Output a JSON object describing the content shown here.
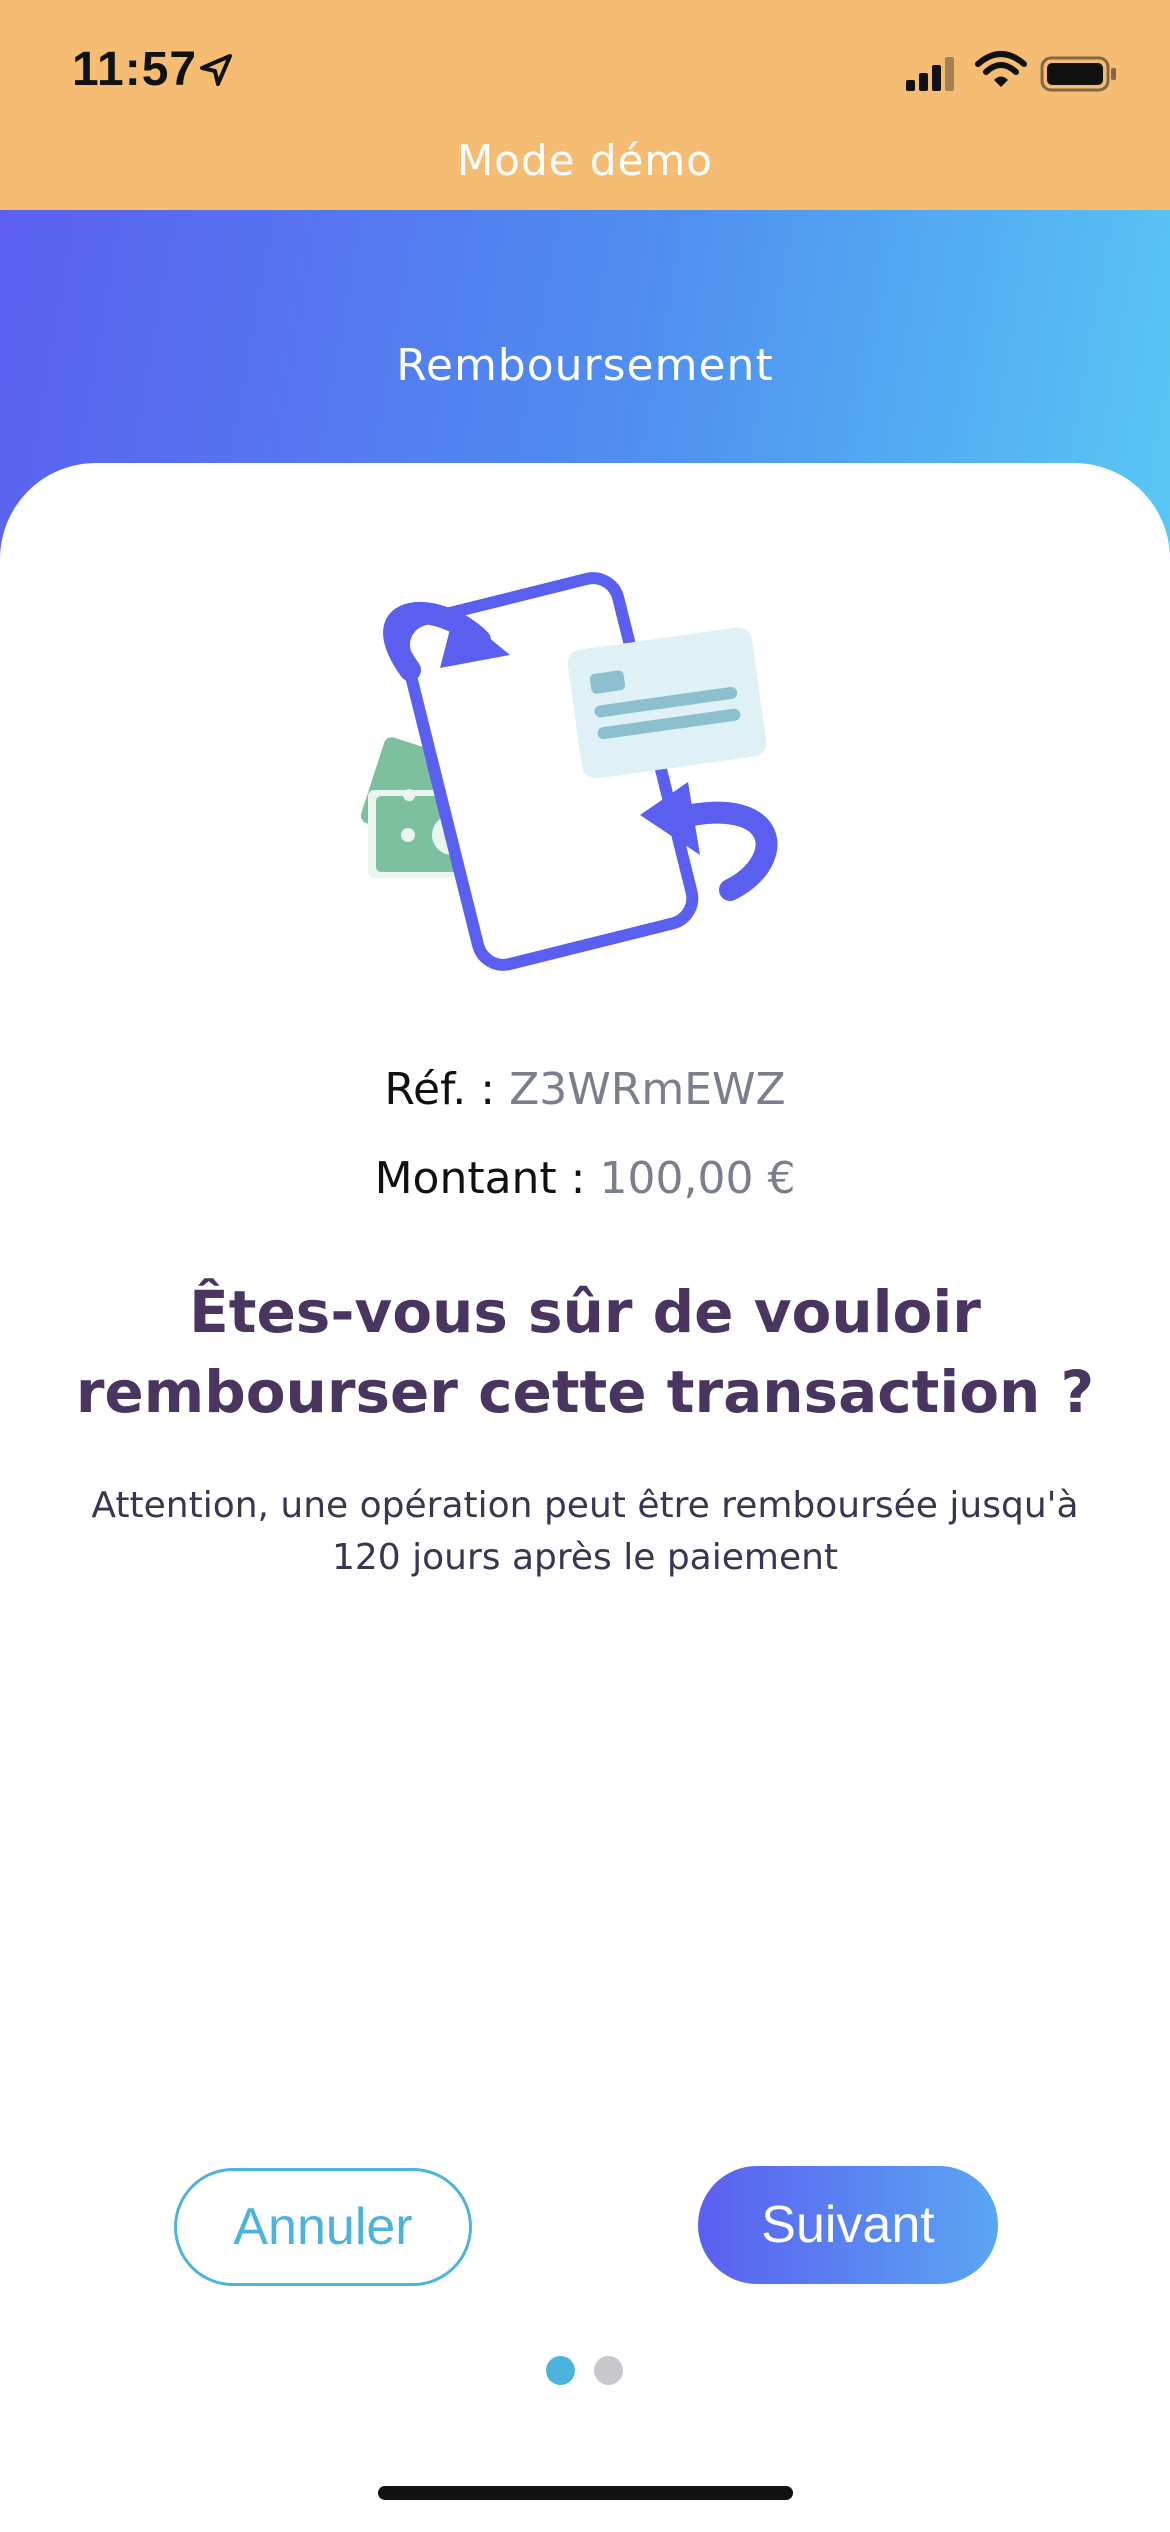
{
  "status_bar": {
    "time": "11:57",
    "icons": [
      "location-arrow-icon",
      "cellular-signal-icon",
      "wifi-icon",
      "battery-icon"
    ]
  },
  "banner": {
    "label": "Mode démo",
    "color": "#f5bd74"
  },
  "header": {
    "title": "Remboursement",
    "gradient": [
      "#5b5ff0",
      "#4f8ff0",
      "#58c8f4"
    ]
  },
  "illustration": {
    "icon": "refund-card-exchange-icon"
  },
  "details": {
    "ref_label": "Réf. :",
    "ref_value": "Z3WRmEWZ",
    "amount_label": "Montant :",
    "amount_value": "100,00 €"
  },
  "question": "Êtes-vous sûr de vouloir rembourser cette transaction ?",
  "warning": "Attention, une opération peut être remboursée jusqu'à 120 jours après le paiement",
  "buttons": {
    "cancel_label": "Annuler",
    "next_label": "Suivant"
  },
  "pager": {
    "current_page": 1,
    "total_pages": 2
  },
  "colors": {
    "accent_blue": "#4cb3dc",
    "primary_purple": "#5b5ff0",
    "question_text": "#4a3560"
  }
}
